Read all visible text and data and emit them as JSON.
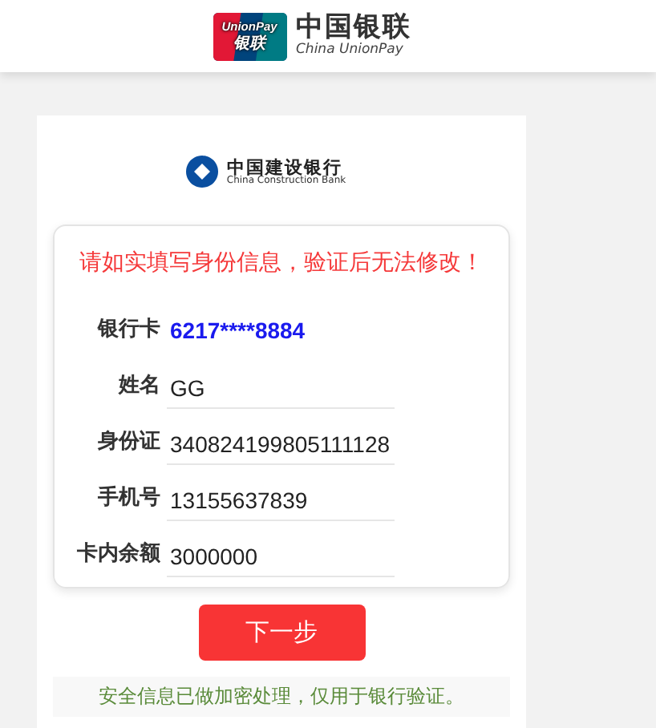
{
  "header": {
    "logo_texts": [
      "UnionPay",
      "银联"
    ],
    "brand_cn": "中国银联",
    "brand_en": "China UnionPay"
  },
  "bank": {
    "name_cn": "中国建设银行",
    "name_en": "China Construction Bank"
  },
  "form": {
    "warning": "请如实填写身份信息，验证后无法修改！",
    "rows": [
      {
        "kind": "text",
        "label": "银行卡",
        "value": "6217****8884"
      },
      {
        "kind": "field",
        "label": "姓名",
        "value": "GG"
      },
      {
        "kind": "field",
        "label": "身份证",
        "value": "340824199805111128"
      },
      {
        "kind": "field",
        "label": "手机号",
        "value": "13155637839"
      },
      {
        "kind": "field",
        "label": "卡内余额",
        "value": "3000000"
      }
    ]
  },
  "next_button": "下一步",
  "security_note": "安全信息已做加密处理，仅用于银行验证。"
}
